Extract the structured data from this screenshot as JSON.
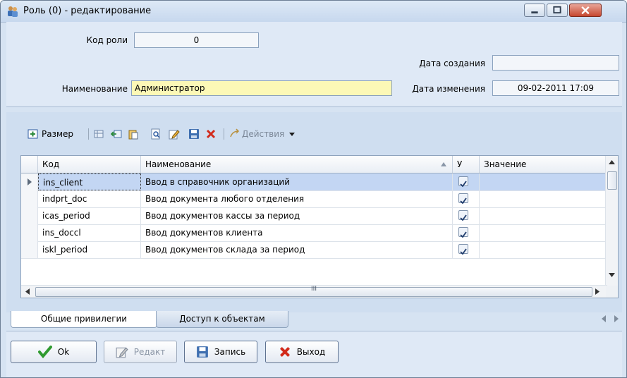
{
  "window": {
    "title": "Роль (0) - редактирование",
    "icon": "role-users-icon",
    "accent": "#c6462e"
  },
  "form": {
    "code_label": "Код роли",
    "code_value": "0",
    "name_label": "Наименование",
    "name_value": "Администратор",
    "created_label": "Дата создания",
    "created_value": "",
    "modified_label": "Дата изменения",
    "modified_value": "09-02-2011 17:09"
  },
  "toolbar": {
    "size_label": "Размер",
    "actions_label": "Действия"
  },
  "grid": {
    "columns": [
      "Код",
      "Наименование",
      "У",
      "Значение"
    ],
    "rows": [
      {
        "code": "ins_client",
        "name": "Ввод в справочник организаций",
        "checked": true,
        "value": ""
      },
      {
        "code": "indprt_doc",
        "name": "Ввод документа любого отделения",
        "checked": true,
        "value": ""
      },
      {
        "code": "icas_period",
        "name": "Ввод документов кассы за период",
        "checked": true,
        "value": ""
      },
      {
        "code": "ins_doccl",
        "name": "Ввод документов клиента",
        "checked": true,
        "value": ""
      },
      {
        "code": "iskl_period",
        "name": "Ввод документов склада за период",
        "checked": true,
        "value": ""
      }
    ],
    "hscroll_label": "III"
  },
  "tabs": [
    "Общие привилегии",
    "Доступ к объектам"
  ],
  "buttons": {
    "ok": "Ok",
    "edit": "Редакт",
    "save": "Запись",
    "exit": "Выход"
  }
}
